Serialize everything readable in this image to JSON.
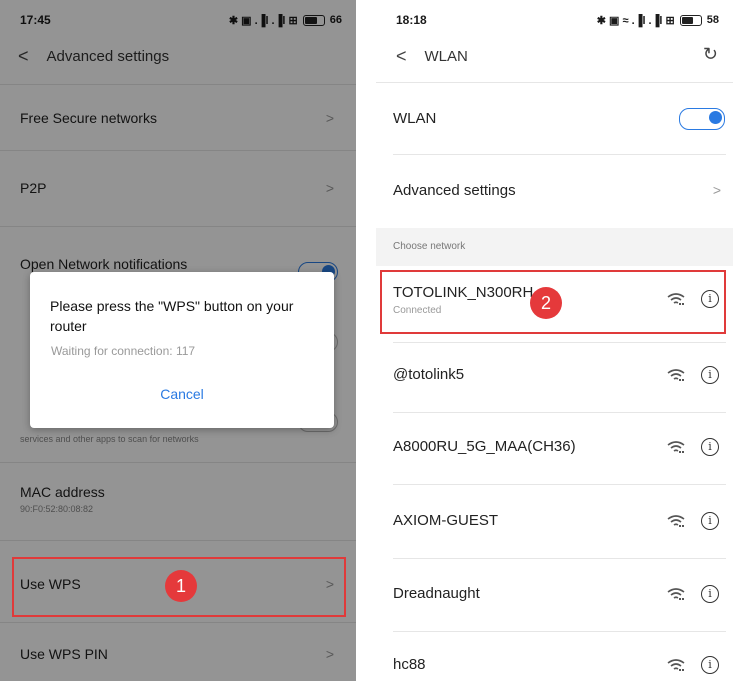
{
  "left": {
    "status": {
      "time": "17:45",
      "signal_text": "✱ ▣ .▐l .▐l ⊞",
      "battery": "66"
    },
    "header": {
      "back": "<",
      "title": "Advanced settings"
    },
    "rows": {
      "free_secure": "Free Secure networks",
      "p2p": "P2P",
      "open_notif": "Open Network notifications",
      "scan_sub": "services and other apps to scan for networks",
      "mac_title": "MAC address",
      "mac_value": "90:F0:52:80:08:82",
      "use_wps": "Use WPS",
      "use_wps_pin": "Use WPS PIN"
    },
    "dialog": {
      "message": "Please press the \"WPS\" button on your router",
      "status": "Waiting for connection: 117",
      "cancel": "Cancel"
    },
    "marker": "1",
    "chevron": ">"
  },
  "right": {
    "status": {
      "time": "18:18",
      "signal_text": "✱ ▣ ≈ .▐l .▐l ⊞",
      "battery": "58"
    },
    "header": {
      "back": "<",
      "title": "WLAN",
      "refresh_icon": "↻"
    },
    "wlan_label": "WLAN",
    "advanced_label": "Advanced settings",
    "section_label": "Choose network",
    "networks": [
      {
        "name": "TOTOLINK_N300RH",
        "sub": "Connected"
      },
      {
        "name": "@totolink5",
        "sub": ""
      },
      {
        "name": "A8000RU_5G_MAA(CH36)",
        "sub": ""
      },
      {
        "name": "AXIOM-GUEST",
        "sub": ""
      },
      {
        "name": "Dreadnaught",
        "sub": ""
      },
      {
        "name": "hc88",
        "sub": ""
      }
    ],
    "marker": "2",
    "chevron": ">",
    "info_glyph": "i"
  },
  "colors": {
    "accent": "#2a7ae2",
    "highlight": "#e03a3a",
    "marker": "#e5393b"
  }
}
